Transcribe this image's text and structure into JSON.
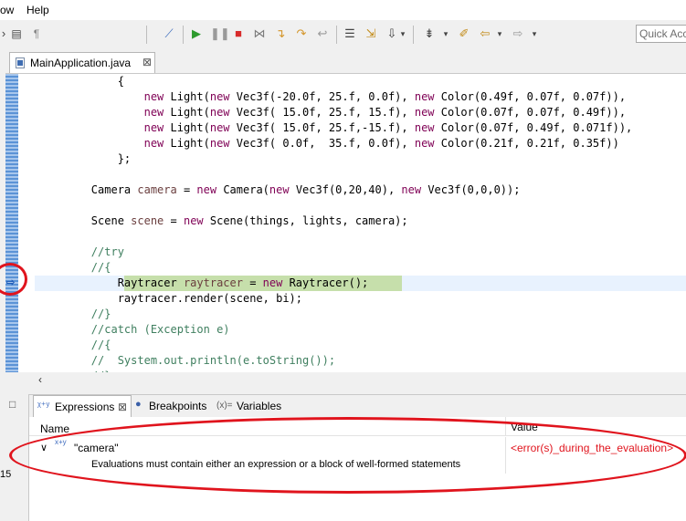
{
  "menu": {
    "window_partial": "ow",
    "help": "Help"
  },
  "toolbar": {
    "quick_access": "Quick Access"
  },
  "editor": {
    "tab_label": "MainApplication.java",
    "tab_close": "⊠",
    "lines": [
      {
        "parts": [
          [
            "",
            "{"
          ]
        ],
        "indent": "            "
      },
      {
        "parts": [
          [
            "kw",
            "new"
          ],
          [
            "",
            " Light("
          ],
          [
            "kw",
            "new"
          ],
          [
            "",
            " Vec3f(-20.0f, 25.f, 0.0f), "
          ],
          [
            "kw",
            "new"
          ],
          [
            "",
            " Color(0.49f, 0.07f, 0.07f)),"
          ]
        ],
        "indent": "                "
      },
      {
        "parts": [
          [
            "kw",
            "new"
          ],
          [
            "",
            " Light("
          ],
          [
            "kw",
            "new"
          ],
          [
            "",
            " Vec3f( 15.0f, 25.f, 15.f), "
          ],
          [
            "kw",
            "new"
          ],
          [
            "",
            " Color(0.07f, 0.07f, 0.49f)),"
          ]
        ],
        "indent": "                "
      },
      {
        "parts": [
          [
            "kw",
            "new"
          ],
          [
            "",
            " Light("
          ],
          [
            "kw",
            "new"
          ],
          [
            "",
            " Vec3f( 15.0f, 25.f,-15.f), "
          ],
          [
            "kw",
            "new"
          ],
          [
            "",
            " Color(0.07f, 0.49f, 0.071f)),"
          ]
        ],
        "indent": "                "
      },
      {
        "parts": [
          [
            "kw",
            "new"
          ],
          [
            "",
            " Light("
          ],
          [
            "kw",
            "new"
          ],
          [
            "",
            " Vec3f( 0.0f,  35.f, 0.0f), "
          ],
          [
            "kw",
            "new"
          ],
          [
            "",
            " Color(0.21f, 0.21f, 0.35f))"
          ]
        ],
        "indent": "                "
      },
      {
        "parts": [
          [
            "",
            "};"
          ]
        ],
        "indent": "            "
      },
      {
        "parts": [],
        "indent": ""
      },
      {
        "parts": [
          [
            "",
            "Camera "
          ],
          [
            "var",
            "camera"
          ],
          [
            "",
            " = "
          ],
          [
            "kw",
            "new"
          ],
          [
            "",
            " Camera("
          ],
          [
            "kw",
            "new"
          ],
          [
            "",
            " Vec3f(0,20,40), "
          ],
          [
            "kw",
            "new"
          ],
          [
            "",
            " Vec3f(0,0,0));"
          ]
        ],
        "indent": "        "
      },
      {
        "parts": [],
        "indent": ""
      },
      {
        "parts": [
          [
            "",
            "Scene "
          ],
          [
            "var",
            "scene"
          ],
          [
            "",
            " = "
          ],
          [
            "kw",
            "new"
          ],
          [
            "",
            " Scene(things, lights, camera);"
          ]
        ],
        "indent": "        "
      },
      {
        "parts": [],
        "indent": ""
      },
      {
        "parts": [
          [
            "cm",
            "//try"
          ]
        ],
        "indent": "        "
      },
      {
        "parts": [
          [
            "cm",
            "//{"
          ]
        ],
        "indent": "        "
      },
      {
        "parts": [
          [
            "",
            "Raytracer "
          ],
          [
            "var",
            "raytracer"
          ],
          [
            "",
            " = "
          ],
          [
            "kw",
            "new"
          ],
          [
            "",
            " Raytracer();"
          ]
        ],
        "indent": "            "
      },
      {
        "parts": [
          [
            "",
            "raytracer.render(scene, bi);"
          ]
        ],
        "indent": "            "
      },
      {
        "parts": [
          [
            "cm",
            "//}"
          ]
        ],
        "indent": "        "
      },
      {
        "parts": [
          [
            "cm",
            "//catch (Exception e)"
          ]
        ],
        "indent": "        "
      },
      {
        "parts": [
          [
            "cm",
            "//{"
          ]
        ],
        "indent": "        "
      },
      {
        "parts": [
          [
            "cm",
            "//  System.out.println(e.toString());"
          ]
        ],
        "indent": "        "
      },
      {
        "parts": [
          [
            "cm",
            "//}"
          ]
        ],
        "indent": "        "
      }
    ]
  },
  "panel": {
    "tabs": [
      {
        "label": "Expressions",
        "close": "⊠"
      },
      {
        "label": "Breakpoints"
      },
      {
        "label": "Variables",
        "prefix": "(x)="
      }
    ],
    "columns": {
      "name": "Name",
      "value": "Value"
    },
    "rows": [
      {
        "expand": "∨",
        "icon": "x+y",
        "name": "\"camera\"",
        "value": "<error(s)_during_the_evaluation>"
      },
      {
        "name": "Evaluations must contain either an expression or a block of well-formed statements",
        "value": ""
      }
    ],
    "left_number": "15"
  },
  "colors": {
    "error": "#e0141d",
    "keyword": "#7f0055",
    "comment": "#3f7f5f"
  }
}
